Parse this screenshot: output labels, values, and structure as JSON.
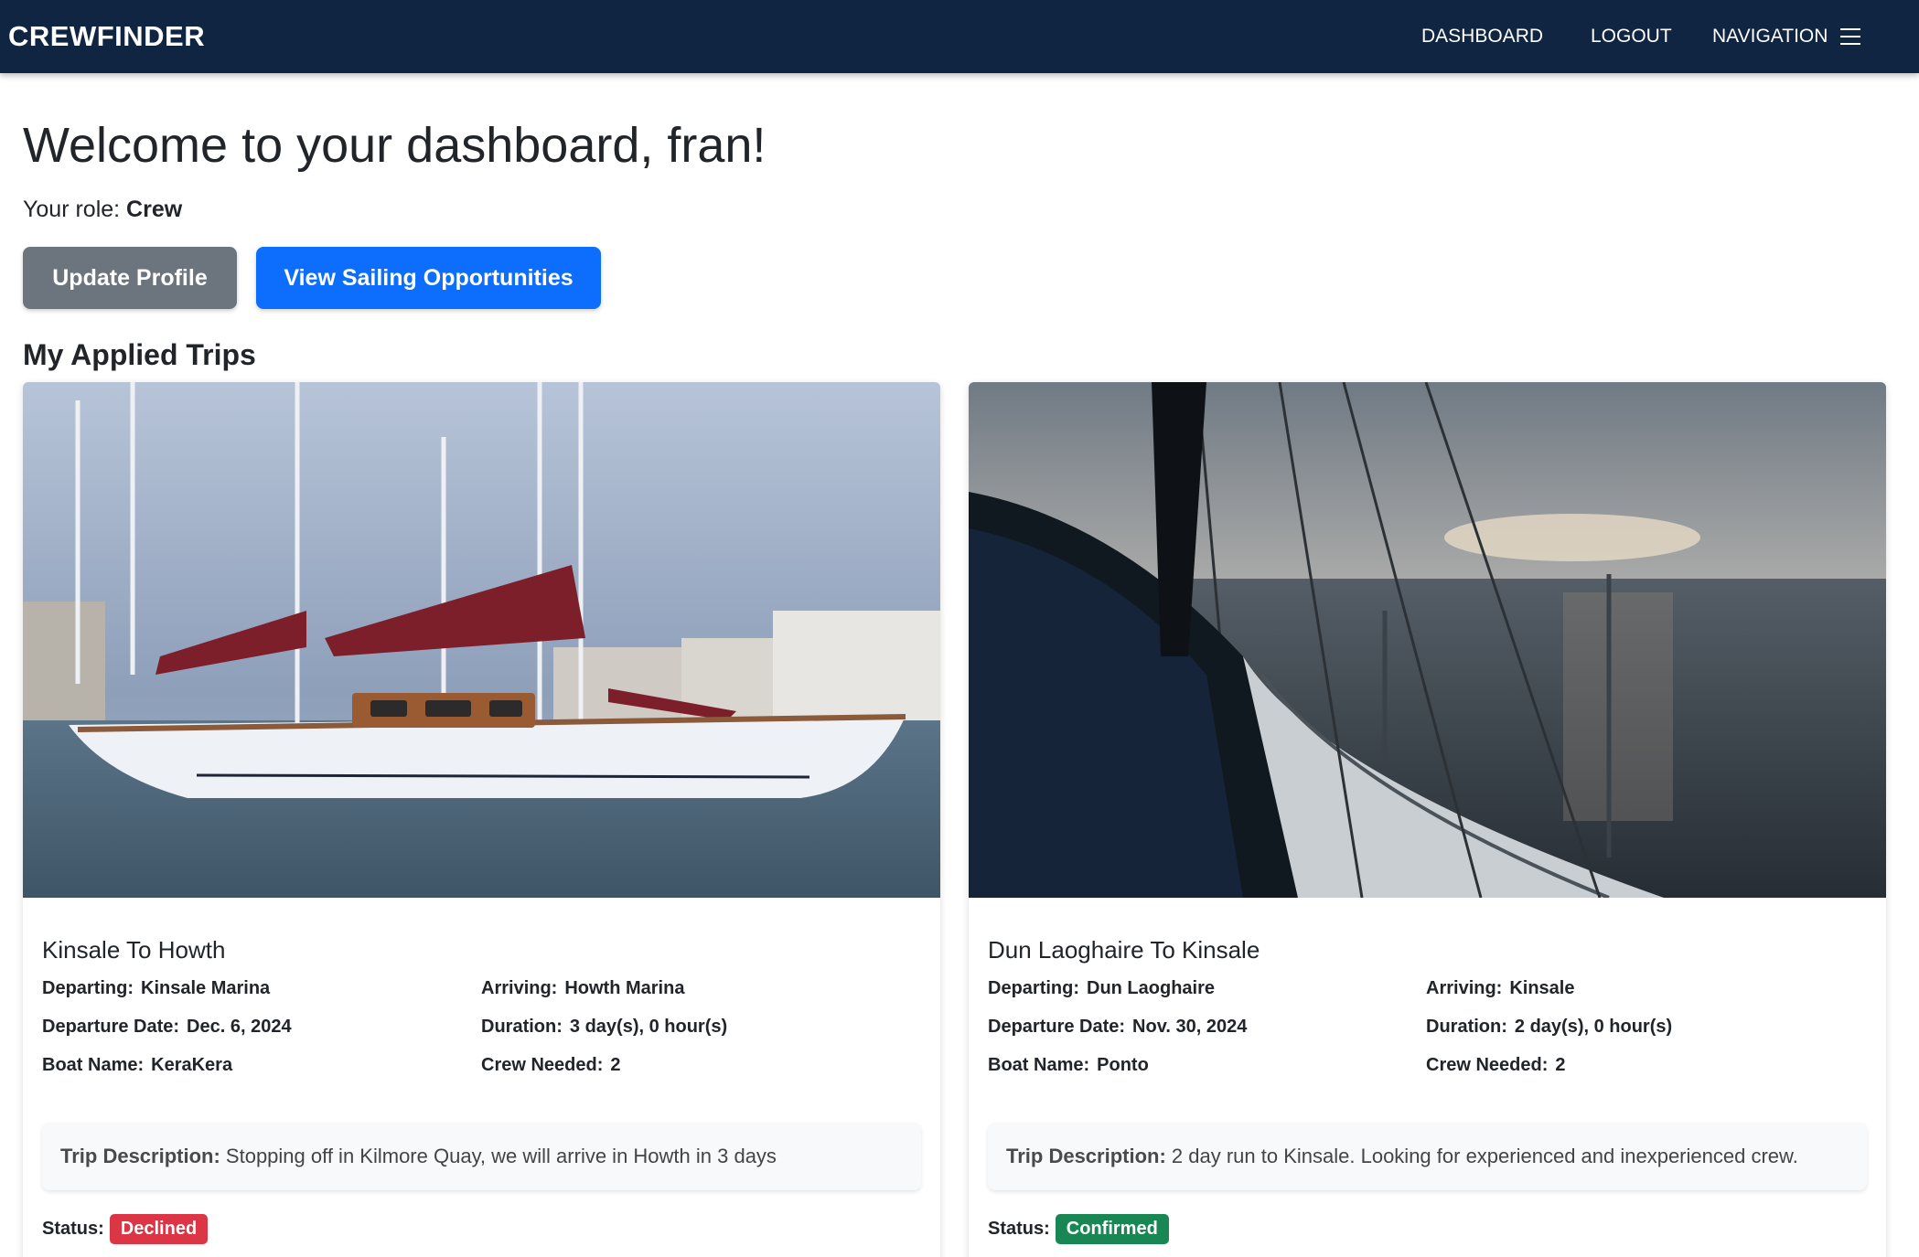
{
  "navbar": {
    "brand": "CREWFINDER",
    "links": {
      "dashboard": "DASHBOARD",
      "logout": "LOGOUT",
      "navigation": "NAVIGATION"
    },
    "menu_icon": "hamburger-icon",
    "bg_color": "#0f2541"
  },
  "header": {
    "welcome": "Welcome to your dashboard, fran!",
    "role_label": "Your role:",
    "role_value": "Crew"
  },
  "actions": {
    "update_profile": "Update Profile",
    "view_opportunities": "View Sailing Opportunities"
  },
  "section_title": "My Applied Trips",
  "trips": [
    {
      "title": "Kinsale To Howth",
      "departing_label": "Departing:",
      "departing": "Kinsale Marina",
      "arriving_label": "Arriving:",
      "arriving": "Howth Marina",
      "departure_date_label": "Departure Date:",
      "departure_date": "Dec. 6, 2024",
      "duration_label": "Duration:",
      "duration": "3 day(s), 0 hour(s)",
      "boat_name_label": "Boat Name:",
      "boat_name": "KeraKera",
      "crew_needed_label": "Crew Needed:",
      "crew_needed": "2",
      "description_label": "Trip Description:",
      "description": "Stopping off in Kilmore Quay, we will arrive in Howth in 3 days",
      "status_label": "Status:",
      "status": "Declined",
      "status_color": "#dc3545"
    },
    {
      "title": "Dun Laoghaire To Kinsale",
      "departing_label": "Departing:",
      "departing": "Dun Laoghaire",
      "arriving_label": "Arriving:",
      "arriving": "Kinsale",
      "departure_date_label": "Departure Date:",
      "departure_date": "Nov. 30, 2024",
      "duration_label": "Duration:",
      "duration": "2 day(s), 0 hour(s)",
      "boat_name_label": "Boat Name:",
      "boat_name": "Ponto",
      "crew_needed_label": "Crew Needed:",
      "crew_needed": "2",
      "description_label": "Trip Description:",
      "description": "2 day run to Kinsale. Looking for experienced and inexperienced crew.",
      "status_label": "Status:",
      "status": "Confirmed",
      "status_color": "#198754"
    }
  ]
}
